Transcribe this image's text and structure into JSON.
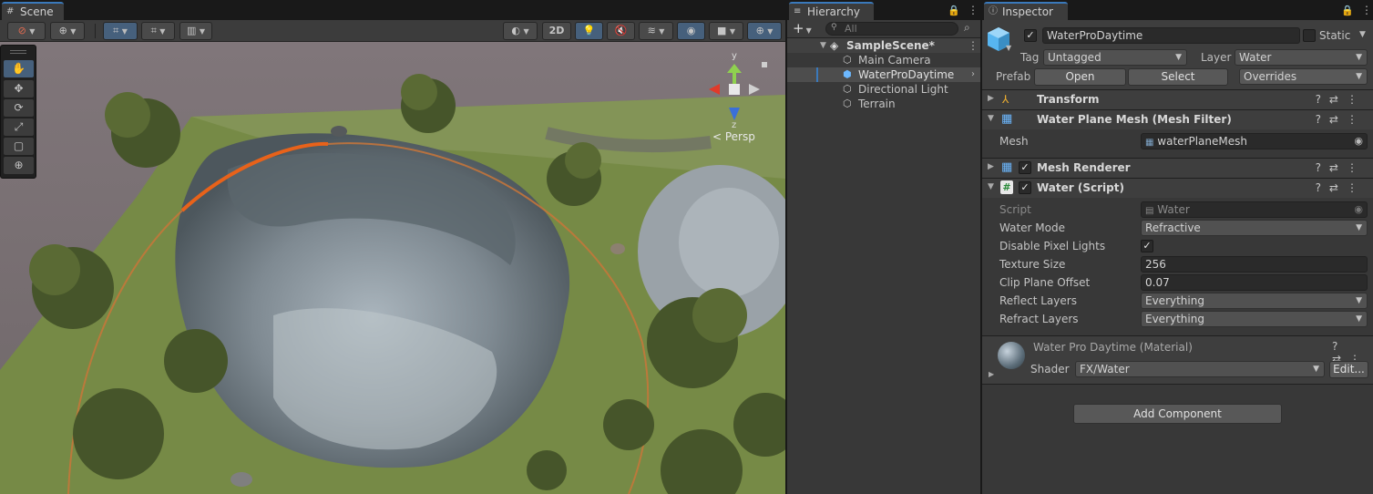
{
  "scene": {
    "tab_label": "Scene",
    "toolbar": {
      "mode_2d": "2D",
      "persp_label": "< Persp",
      "gizmo_axes": {
        "y": "y",
        "z": "z"
      }
    }
  },
  "hierarchy": {
    "tab_label": "Hierarchy",
    "search_placeholder": "All",
    "scene_name": "SampleScene*",
    "items": [
      {
        "label": "Main Camera"
      },
      {
        "label": "WaterProDaytime"
      },
      {
        "label": "Directional Light"
      },
      {
        "label": "Terrain"
      }
    ]
  },
  "inspector": {
    "tab_label": "Inspector",
    "object_name": "WaterProDaytime",
    "static_label": "Static",
    "tag_label": "Tag",
    "tag_value": "Untagged",
    "layer_label": "Layer",
    "layer_value": "Water",
    "prefab_label": "Prefab",
    "prefab_open": "Open",
    "prefab_select": "Select",
    "prefab_overrides": "Overrides",
    "components": {
      "transform": "Transform",
      "mesh_filter": "Water Plane Mesh (Mesh Filter)",
      "mesh_label": "Mesh",
      "mesh_value": "waterPlaneMesh",
      "mesh_renderer": "Mesh Renderer",
      "water_script": "Water (Script)"
    },
    "water_props": [
      {
        "label": "Script",
        "value": "Water"
      },
      {
        "label": "Water Mode",
        "value": "Refractive"
      },
      {
        "label": "Disable Pixel Lights",
        "value": "✓"
      },
      {
        "label": "Texture Size",
        "value": "256"
      },
      {
        "label": "Clip Plane Offset",
        "value": "0.07"
      },
      {
        "label": "Reflect Layers",
        "value": "Everything"
      },
      {
        "label": "Refract Layers",
        "value": "Everything"
      }
    ],
    "material": {
      "name": "Water Pro Daytime (Material)",
      "shader_label": "Shader",
      "shader_value": "FX/Water",
      "edit_label": "Edit..."
    },
    "add_component": "Add Component"
  },
  "colors": {
    "accent": "#3a79bb",
    "selection": "#4d4d4d",
    "panel": "#383838",
    "handle_ring": "#e07a2a"
  }
}
